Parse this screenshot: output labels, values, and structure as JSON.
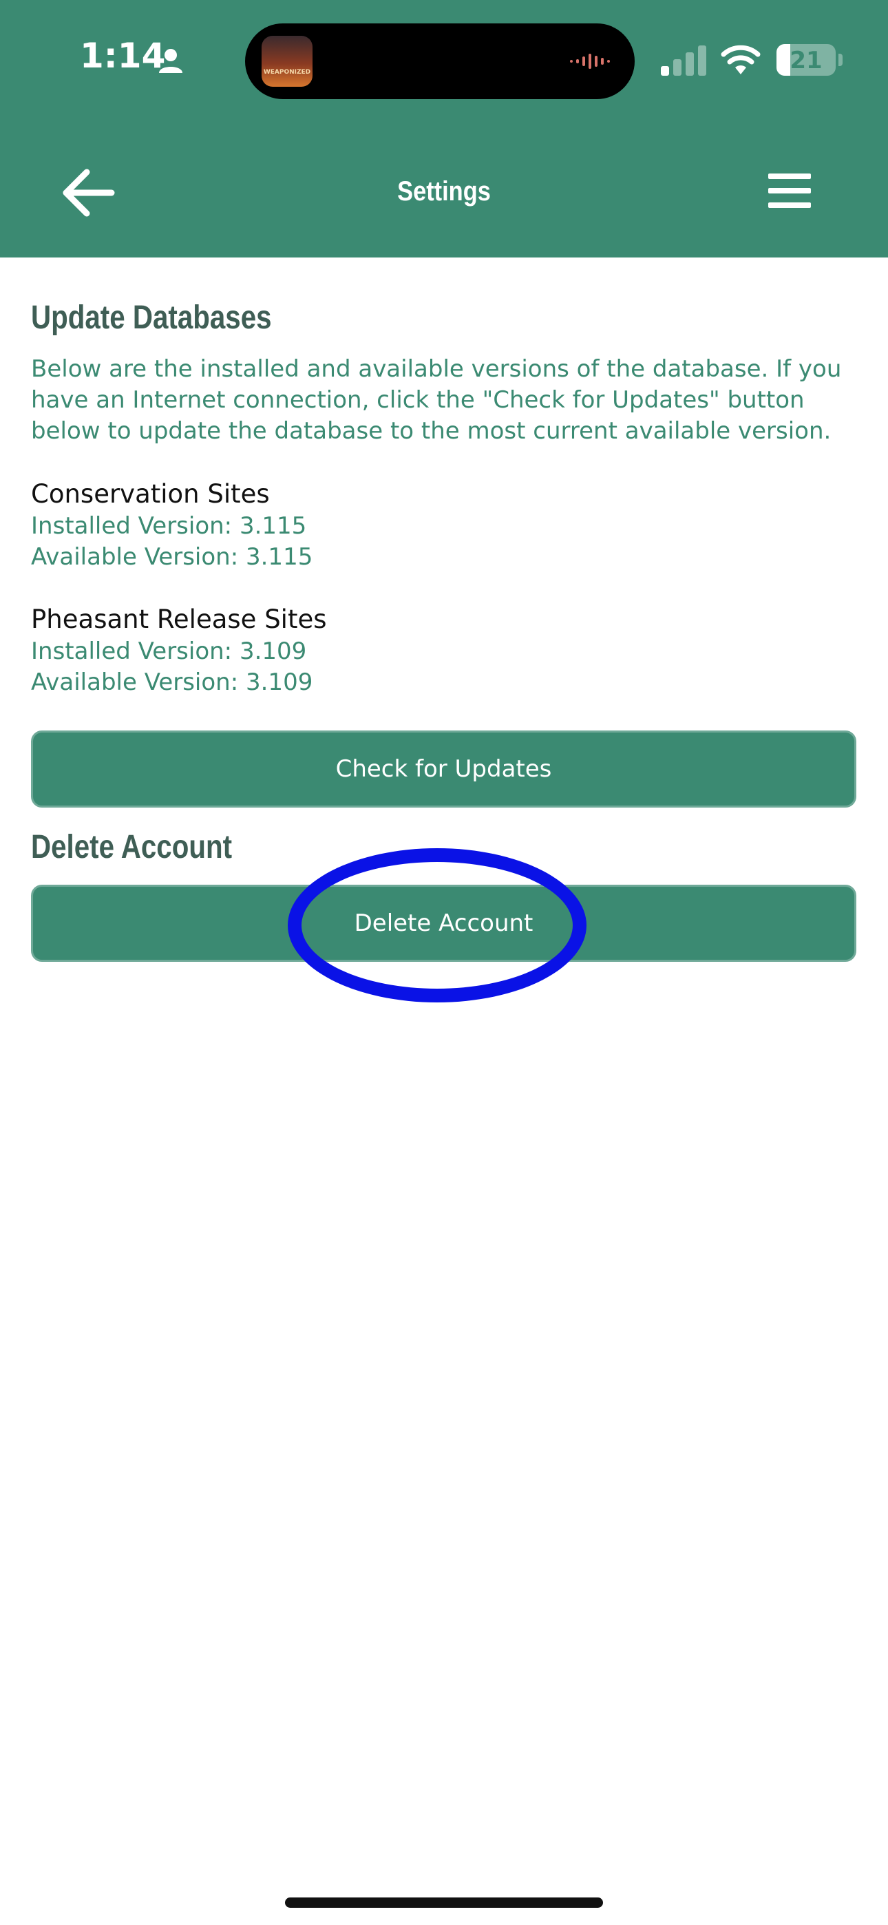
{
  "status_bar": {
    "time": "1:14",
    "battery": "21",
    "island_thumb_text": "WEAPONIZED",
    "icons": [
      "person-icon",
      "signal-icon",
      "wifi-icon",
      "battery-icon"
    ]
  },
  "header": {
    "title": "Settings",
    "back_icon": "arrow-left-icon",
    "menu_icon": "hamburger-icon",
    "background": "#3b8a72"
  },
  "update_section": {
    "heading": "Update Databases",
    "intro": "Below are the installed and available versions of the database. If you have an Internet connection, click the \"Check for Updates\" button below to update the database to the most current available version.",
    "databases": [
      {
        "name": "Conservation Sites",
        "installed": "Installed Version: 3.115",
        "available": "Available Version: 3.115"
      },
      {
        "name": "Pheasant Release Sites",
        "installed": "Installed Version: 3.109",
        "available": "Available Version: 3.109"
      }
    ],
    "check_button": "Check for Updates"
  },
  "delete_section": {
    "heading": "Delete Account",
    "delete_button": "Delete Account"
  },
  "colors": {
    "accent": "#3b8a72",
    "heading": "#3f5e55",
    "annotation": "#0a12e6"
  }
}
